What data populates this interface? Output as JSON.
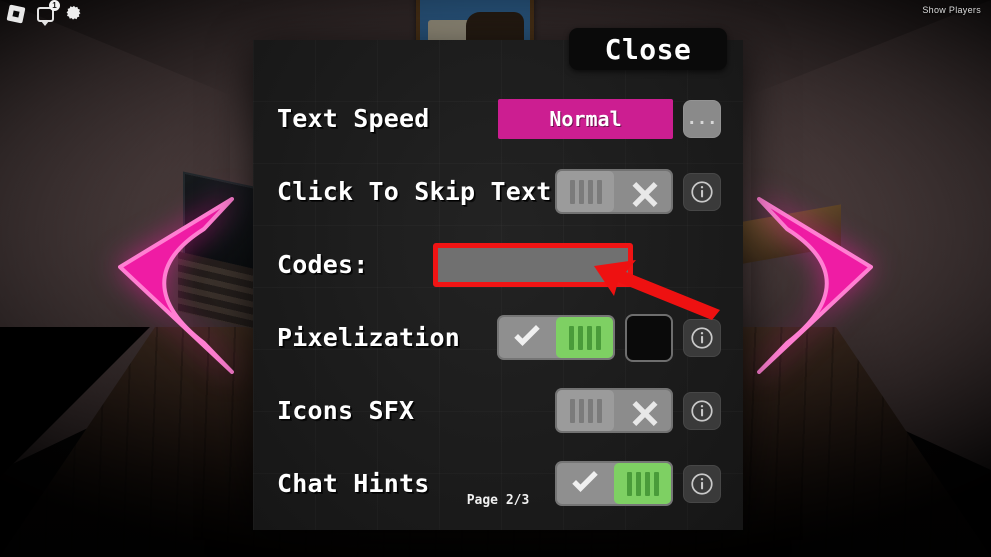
{
  "hud": {
    "roblox_logo": "roblox-logo-icon",
    "chat_icon": "chat-icon",
    "chat_badge": "1",
    "settings_icon": "gear-icon",
    "show_players_label": "Show Players"
  },
  "nav": {
    "prev_arrow": "previous-page-arrow",
    "next_arrow": "next-page-arrow",
    "accent_color": "#ef1ca4"
  },
  "dialog": {
    "close_label": "Close",
    "page_indicator": "Page 2/3",
    "accent_color": "#cc1e91",
    "on_color": "#7ed063",
    "off_color": "#9b9b9b",
    "rows": [
      {
        "label": "Text Speed",
        "control": "value",
        "value": "Normal",
        "more_label": "...",
        "has_info": false
      },
      {
        "label": "Click To Skip Text",
        "control": "toggle",
        "state": "off",
        "state_icon": "x-icon",
        "has_info": true
      },
      {
        "label": "Codes:",
        "control": "input",
        "value": "",
        "placeholder": "",
        "has_info": false
      },
      {
        "label": "Pixelization",
        "control": "toggle",
        "state": "on",
        "state_icon": "check-icon",
        "swatch": "#0a0a0a",
        "has_swatch": true,
        "has_info": true
      },
      {
        "label": "Icons SFX",
        "control": "toggle",
        "state": "off",
        "state_icon": "x-icon",
        "has_info": true
      },
      {
        "label": "Chat Hints",
        "control": "toggle",
        "state": "on",
        "state_icon": "check-icon",
        "has_info": true
      }
    ]
  },
  "annotation": {
    "arrow": "red-pointer-arrow",
    "color": "#f01414",
    "target": "codes-input"
  }
}
